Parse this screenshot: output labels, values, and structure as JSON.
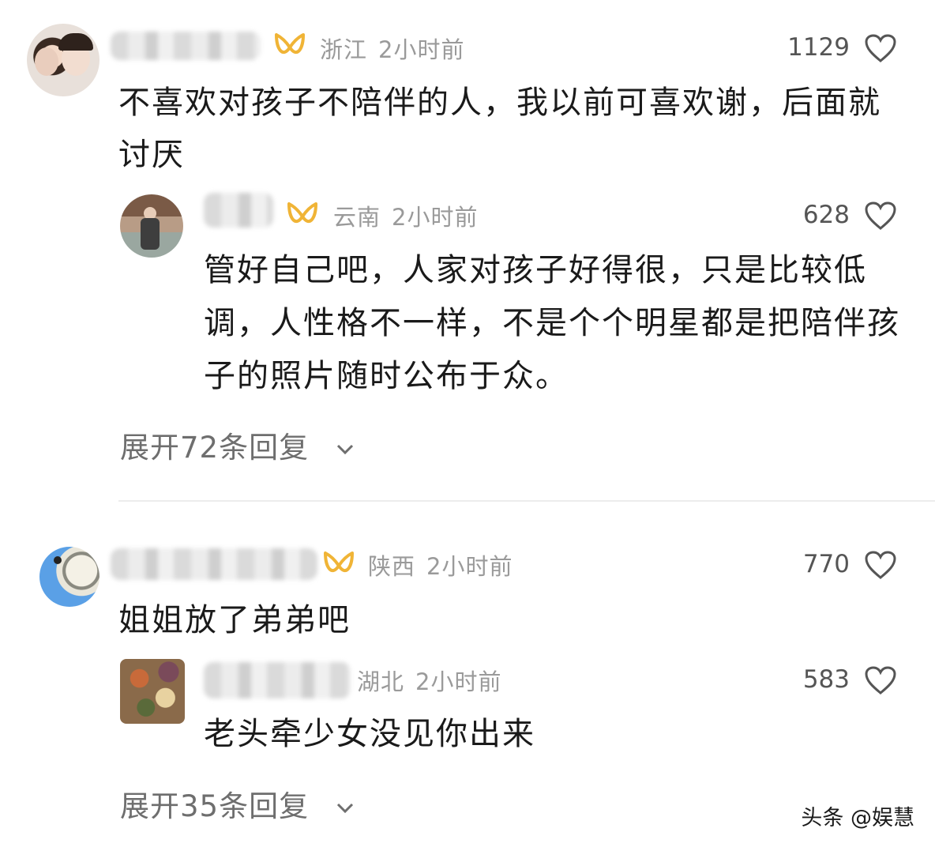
{
  "comments": [
    {
      "location": "浙江",
      "time": "2小时前",
      "likes": "1129",
      "text": "不喜欢对孩子不陪伴的人，我以前可喜欢谢，后面就讨厌",
      "reply": {
        "location": "云南",
        "time": "2小时前",
        "likes": "628",
        "text": "管好自己吧，人家对孩子好得很，只是比较低调，人性格不一样，不是个个明星都是把陪伴孩子的照片随时公布于众。"
      },
      "expand_label": "展开72条回复"
    },
    {
      "location": "陕西",
      "time": "2小时前",
      "likes": "770",
      "text": "姐姐放了弟弟吧",
      "reply": {
        "location": "湖北",
        "time": "2小时前",
        "likes": "583",
        "text": "老头牵少女没见你出来"
      },
      "expand_label": "展开35条回复"
    }
  ],
  "watermark": "头条 @娱慧",
  "colors": {
    "badge": "#f0b436",
    "meta": "#9a9a9a",
    "text": "#1a1a1a"
  },
  "icons": [
    "heart-outline-icon",
    "chevron-down-icon",
    "vip-badge-icon"
  ]
}
